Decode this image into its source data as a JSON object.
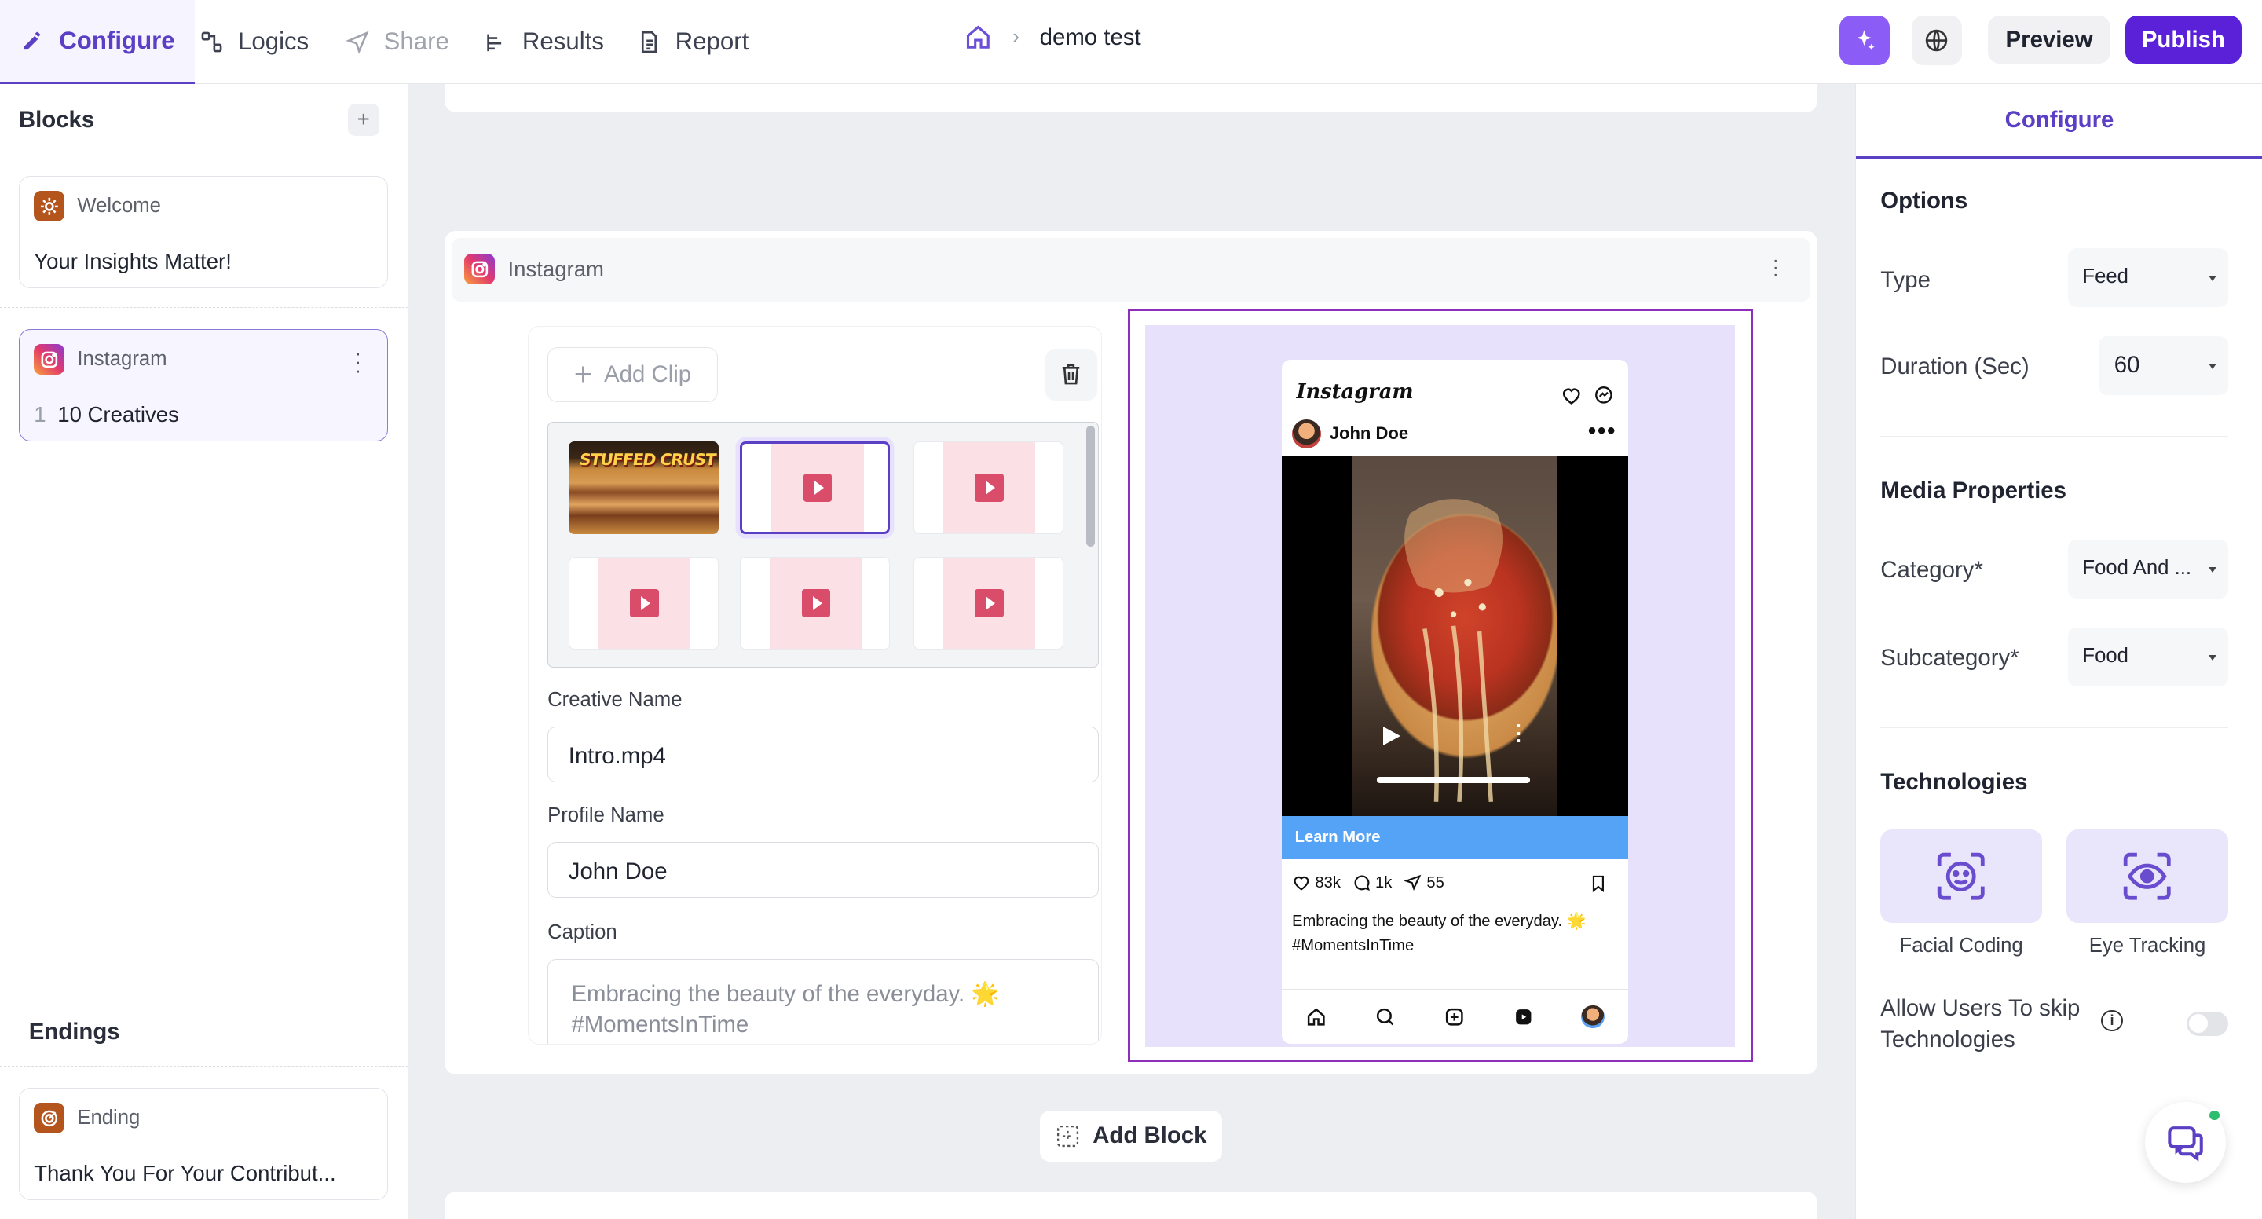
{
  "nav": {
    "tabs": [
      {
        "label": "Configure",
        "icon": "pencil-icon"
      },
      {
        "label": "Logics",
        "icon": "logic-icon"
      },
      {
        "label": "Share",
        "icon": "send-icon"
      },
      {
        "label": "Results",
        "icon": "chart-icon"
      },
      {
        "label": "Report",
        "icon": "document-icon"
      }
    ],
    "breadcrumb": {
      "current": "demo test"
    },
    "preview_label": "Preview",
    "publish_label": "Publish",
    "accent": "#5b21d9"
  },
  "sidebar": {
    "title": "Blocks",
    "blocks": [
      {
        "type": "Welcome",
        "text": "Your Insights Matter!"
      },
      {
        "type": "Instagram",
        "index": "1",
        "text": "10 Creatives"
      }
    ],
    "endings_title": "Endings",
    "ending": {
      "type": "Ending",
      "text": "Thank You For Your Contribut..."
    }
  },
  "block": {
    "title": "Instagram",
    "add_clip_label": "Add Clip",
    "thumb_title": "STUFFED CRUST",
    "creative_name_label": "Creative Name",
    "creative_name_value": "Intro.mp4",
    "profile_name_label": "Profile Name",
    "profile_name_value": "John Doe",
    "caption_label": "Caption",
    "caption_line1": "Embracing the beauty of the everyday. 🌟",
    "caption_line2": "#MomentsInTime"
  },
  "phone": {
    "app_name": "Instagram",
    "user": "John Doe",
    "cta": "Learn More",
    "likes": "83k",
    "comments": "1k",
    "shares": "55",
    "caption_line1": "Embracing the beauty of the everyday. 🌟",
    "caption_line2": "#MomentsInTime"
  },
  "add_block_label": "Add Block",
  "panel": {
    "tab": "Configure",
    "options_title": "Options",
    "type_label": "Type",
    "type_value": "Feed",
    "duration_label": "Duration (Sec)",
    "duration_value": "60",
    "media_title": "Media Properties",
    "category_label": "Category*",
    "category_value": "Food And ...",
    "subcategory_label": "Subcategory*",
    "subcategory_value": "Food",
    "tech_title": "Technologies",
    "tech_facial": "Facial Coding",
    "tech_eye": "Eye Tracking",
    "allow_skip_label": "Allow Users To skip Technologies",
    "allow_skip_on": false
  }
}
